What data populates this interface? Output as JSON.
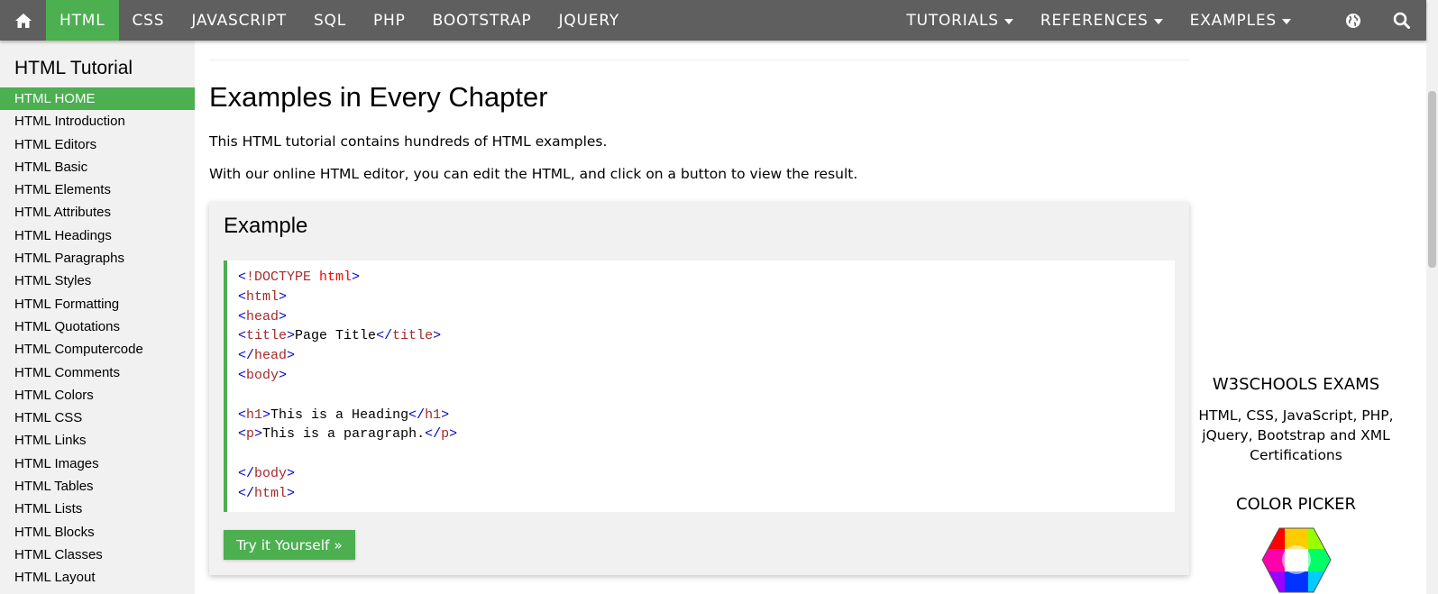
{
  "nav": {
    "items": [
      "HTML",
      "CSS",
      "JAVASCRIPT",
      "SQL",
      "PHP",
      "BOOTSTRAP",
      "JQUERY"
    ],
    "dropdowns": [
      "TUTORIALS",
      "REFERENCES",
      "EXAMPLES"
    ],
    "accent": "#4CAF50",
    "bar_color": "#5f5f5f",
    "icons": [
      "home-icon",
      "globe-icon",
      "search-icon"
    ]
  },
  "sidebar": {
    "title": "HTML Tutorial",
    "items": [
      "HTML HOME",
      "HTML Introduction",
      "HTML Editors",
      "HTML Basic",
      "HTML Elements",
      "HTML Attributes",
      "HTML Headings",
      "HTML Paragraphs",
      "HTML Styles",
      "HTML Formatting",
      "HTML Quotations",
      "HTML Computercode",
      "HTML Comments",
      "HTML Colors",
      "HTML CSS",
      "HTML Links",
      "HTML Images",
      "HTML Tables",
      "HTML Lists",
      "HTML Blocks",
      "HTML Classes",
      "HTML Layout"
    ],
    "active_index": 0
  },
  "main": {
    "heading": "Examples in Every Chapter",
    "para1": "This HTML tutorial contains hundreds of HTML examples.",
    "para2": "With our online HTML editor, you can edit the HTML, and click on a button to view the result.",
    "example": {
      "title": "Example",
      "button": "Try it Yourself »",
      "code": {
        "l1a": "<",
        "l1b": "!DOCTYPE",
        "l1c": " html",
        "l1d": ">",
        "l2a": "<",
        "l2b": "html",
        "l2c": ">",
        "l3a": "<",
        "l3b": "head",
        "l3c": ">",
        "l4a": "<",
        "l4b": "title",
        "l4c": ">",
        "l4d": "Page Title",
        "l4e": "</",
        "l4f": "title",
        "l4g": ">",
        "l5a": "</",
        "l5b": "head",
        "l5c": ">",
        "l6a": "<",
        "l6b": "body",
        "l6c": ">",
        "l8a": "<",
        "l8b": "h1",
        "l8c": ">",
        "l8d": "This is a Heading",
        "l8e": "</",
        "l8f": "h1",
        "l8g": ">",
        "l9a": "<",
        "l9b": "p",
        "l9c": ">",
        "l9d": "This is a paragraph.",
        "l9e": "</",
        "l9f": "p",
        "l9g": ">",
        "l11a": "</",
        "l11b": "body",
        "l11c": ">",
        "l12a": "</",
        "l12b": "html",
        "l12c": ">"
      }
    }
  },
  "right": {
    "exams_title": "W3SCHOOLS EXAMS",
    "exams_text_1": "HTML, CSS, JavaScript, PHP,",
    "exams_text_2": "jQuery, Bootstrap and XML",
    "exams_text_3": "Certifications",
    "picker_title": "COLOR PICKER"
  }
}
